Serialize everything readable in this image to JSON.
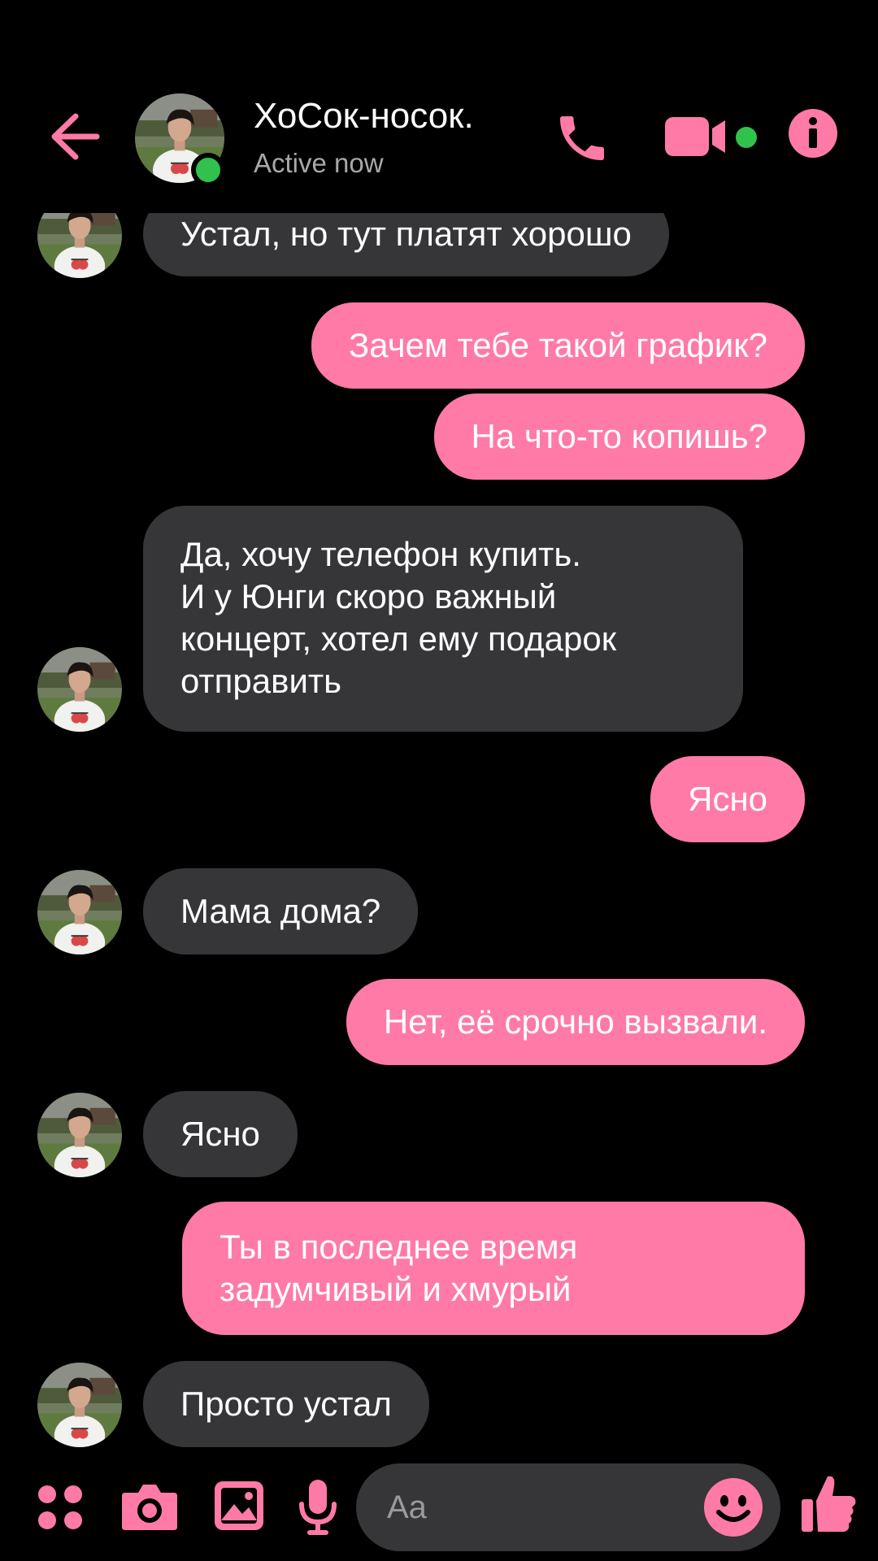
{
  "theme": {
    "accent": "#ff7aa6",
    "incoming_bubble": "#363538",
    "background": "#000000",
    "online": "#31c24d"
  },
  "header": {
    "back_icon": "arrow-left-icon",
    "contact_name": "ХоСок-носок.",
    "status": "Active now",
    "actions": [
      {
        "name": "voice-call",
        "icon": "phone-icon"
      },
      {
        "name": "video-call",
        "icon": "video-camera-icon"
      },
      {
        "name": "info",
        "icon": "info-icon"
      }
    ]
  },
  "messages": [
    {
      "from": "them",
      "lines": [
        "Устал, но тут платят хорошо"
      ],
      "avatar": true
    },
    {
      "from": "me",
      "lines": [
        "Зачем тебе такой график?"
      ]
    },
    {
      "from": "me",
      "lines": [
        "На что-то копишь?"
      ]
    },
    {
      "from": "them",
      "lines": [
        "Да, хочу телефон купить.",
        "И у Юнги скоро важный",
        "концерт, хотел ему подарок",
        "отправить"
      ],
      "avatar": true
    },
    {
      "from": "me",
      "lines": [
        "Ясно"
      ]
    },
    {
      "from": "them",
      "lines": [
        "Мама дома?"
      ],
      "avatar": true
    },
    {
      "from": "me",
      "lines": [
        "Нет, её срочно вызвали."
      ]
    },
    {
      "from": "them",
      "lines": [
        "Ясно"
      ],
      "avatar": true
    },
    {
      "from": "me",
      "lines": [
        "Ты в последнее время",
        "задумчивый и хмурый"
      ]
    },
    {
      "from": "them",
      "lines": [
        "Просто устал"
      ],
      "avatar": true
    }
  ],
  "composer": {
    "placeholder": "Aa",
    "icons": [
      "apps-icon",
      "camera-icon",
      "gallery-icon",
      "microphone-icon",
      "emoji-icon",
      "thumbs-up-icon"
    ]
  }
}
